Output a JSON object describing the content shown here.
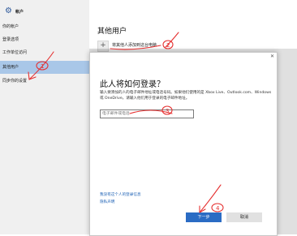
{
  "sidebar": {
    "header_icon": "gear-icon",
    "title": "帐户",
    "items": [
      {
        "label": "你的帐户"
      },
      {
        "label": "登录选项"
      },
      {
        "label": "工作单位访问"
      },
      {
        "label": "其他用户"
      },
      {
        "label": "同步你的设置"
      }
    ],
    "selected_index": 3
  },
  "main": {
    "title": "其他用户",
    "add_icon": "plus-icon",
    "add_label": "将其他人添加到这台电脑"
  },
  "dialog": {
    "close_glyph": "✕",
    "title": "此人将如何登录？",
    "description": "输入要添加的人的电子邮件地址或电话号码。如果他们使用的是 Xbox Live、Outlook.com、Windows 或 OneDrive，请输入他们用于登录的电子邮件地址。",
    "input_placeholder": "电子邮件或电话",
    "link_no_info": "我没有这个人的登录信息",
    "link_privacy": "隐私声明",
    "next_label": "下一步",
    "cancel_label": "取消"
  },
  "annotations": {
    "color": "#e53030",
    "mark_1": "1",
    "mark_2": "2",
    "mark_3": "3",
    "mark_4": "4"
  }
}
